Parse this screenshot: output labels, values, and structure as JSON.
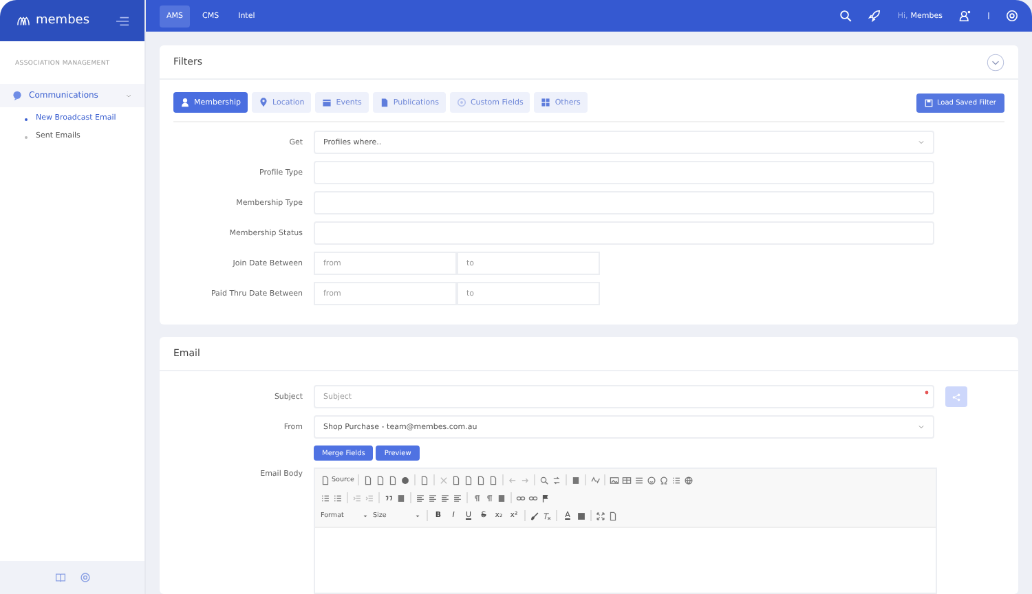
{
  "brand": {
    "name": "membes"
  },
  "top_tabs": [
    {
      "label": "AMS",
      "selected": true
    },
    {
      "label": "CMS",
      "selected": false
    },
    {
      "label": "Intel",
      "selected": false
    }
  ],
  "user": {
    "greeting": "Hi,",
    "name": "Membes"
  },
  "sidebar": {
    "section": "ASSOCIATION MANAGEMENT",
    "items": [
      {
        "label": "Communications",
        "expanded": true,
        "children": [
          {
            "label": "New Broadcast Email",
            "selected": true
          },
          {
            "label": "Sent Emails",
            "selected": false
          }
        ]
      }
    ]
  },
  "filters": {
    "title": "Filters",
    "load_button": "Load Saved Filter",
    "tabs": [
      {
        "label": "Membership",
        "selected": true
      },
      {
        "label": "Location",
        "selected": false
      },
      {
        "label": "Events",
        "selected": false
      },
      {
        "label": "Publications",
        "selected": false
      },
      {
        "label": "Custom Fields",
        "selected": false
      },
      {
        "label": "Others",
        "selected": false
      }
    ],
    "rows": [
      {
        "label": "Get",
        "kind": "select",
        "value": "Profiles where.."
      },
      {
        "label": "Profile Type",
        "kind": "text"
      },
      {
        "label": "Membership Type",
        "kind": "text"
      },
      {
        "label": "Membership Status",
        "kind": "text"
      },
      {
        "label": "Join Date Between",
        "kind": "range",
        "from_placeholder": "from",
        "to_placeholder": "to"
      },
      {
        "label": "Paid Thru Date Between",
        "kind": "range",
        "from_placeholder": "from",
        "to_placeholder": "to"
      }
    ]
  },
  "email": {
    "title": "Email",
    "subject": {
      "label": "Subject",
      "placeholder": "Subject",
      "required": true
    },
    "from": {
      "label": "From",
      "value": "Shop Purchase - team@membes.com.au"
    },
    "buttons": [
      "Merge Fields",
      "Preview"
    ],
    "body": {
      "label": "Email Body",
      "source": "Source",
      "format": "Format",
      "size": "Size",
      "styles": [
        "B",
        "I",
        "U",
        "S",
        "x₂",
        "x²"
      ],
      "text_color": "A"
    }
  }
}
